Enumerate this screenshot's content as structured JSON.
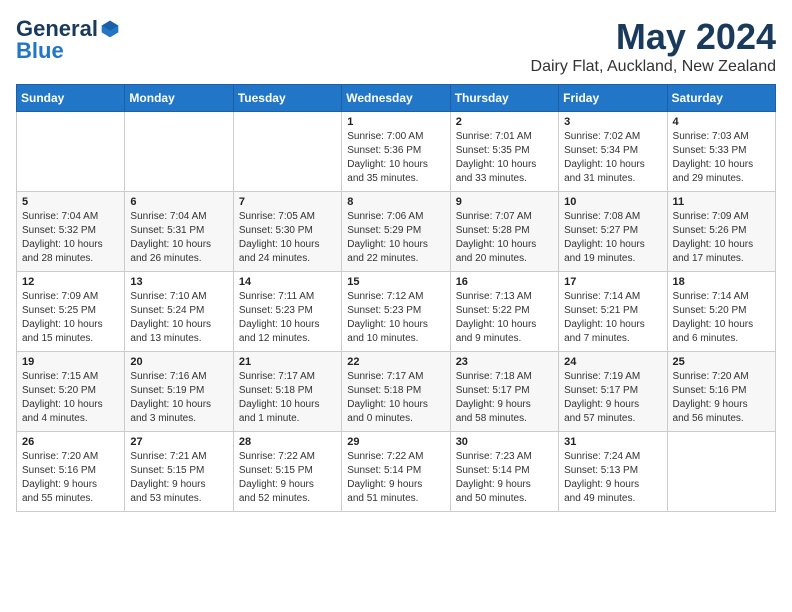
{
  "header": {
    "logo_general": "General",
    "logo_blue": "Blue",
    "month_title": "May 2024",
    "subtitle": "Dairy Flat, Auckland, New Zealand"
  },
  "days_of_week": [
    "Sunday",
    "Monday",
    "Tuesday",
    "Wednesday",
    "Thursday",
    "Friday",
    "Saturday"
  ],
  "weeks": [
    [
      {
        "day": "",
        "info": ""
      },
      {
        "day": "",
        "info": ""
      },
      {
        "day": "",
        "info": ""
      },
      {
        "day": "1",
        "info": "Sunrise: 7:00 AM\nSunset: 5:36 PM\nDaylight: 10 hours\nand 35 minutes."
      },
      {
        "day": "2",
        "info": "Sunrise: 7:01 AM\nSunset: 5:35 PM\nDaylight: 10 hours\nand 33 minutes."
      },
      {
        "day": "3",
        "info": "Sunrise: 7:02 AM\nSunset: 5:34 PM\nDaylight: 10 hours\nand 31 minutes."
      },
      {
        "day": "4",
        "info": "Sunrise: 7:03 AM\nSunset: 5:33 PM\nDaylight: 10 hours\nand 29 minutes."
      }
    ],
    [
      {
        "day": "5",
        "info": "Sunrise: 7:04 AM\nSunset: 5:32 PM\nDaylight: 10 hours\nand 28 minutes."
      },
      {
        "day": "6",
        "info": "Sunrise: 7:04 AM\nSunset: 5:31 PM\nDaylight: 10 hours\nand 26 minutes."
      },
      {
        "day": "7",
        "info": "Sunrise: 7:05 AM\nSunset: 5:30 PM\nDaylight: 10 hours\nand 24 minutes."
      },
      {
        "day": "8",
        "info": "Sunrise: 7:06 AM\nSunset: 5:29 PM\nDaylight: 10 hours\nand 22 minutes."
      },
      {
        "day": "9",
        "info": "Sunrise: 7:07 AM\nSunset: 5:28 PM\nDaylight: 10 hours\nand 20 minutes."
      },
      {
        "day": "10",
        "info": "Sunrise: 7:08 AM\nSunset: 5:27 PM\nDaylight: 10 hours\nand 19 minutes."
      },
      {
        "day": "11",
        "info": "Sunrise: 7:09 AM\nSunset: 5:26 PM\nDaylight: 10 hours\nand 17 minutes."
      }
    ],
    [
      {
        "day": "12",
        "info": "Sunrise: 7:09 AM\nSunset: 5:25 PM\nDaylight: 10 hours\nand 15 minutes."
      },
      {
        "day": "13",
        "info": "Sunrise: 7:10 AM\nSunset: 5:24 PM\nDaylight: 10 hours\nand 13 minutes."
      },
      {
        "day": "14",
        "info": "Sunrise: 7:11 AM\nSunset: 5:23 PM\nDaylight: 10 hours\nand 12 minutes."
      },
      {
        "day": "15",
        "info": "Sunrise: 7:12 AM\nSunset: 5:23 PM\nDaylight: 10 hours\nand 10 minutes."
      },
      {
        "day": "16",
        "info": "Sunrise: 7:13 AM\nSunset: 5:22 PM\nDaylight: 10 hours\nand 9 minutes."
      },
      {
        "day": "17",
        "info": "Sunrise: 7:14 AM\nSunset: 5:21 PM\nDaylight: 10 hours\nand 7 minutes."
      },
      {
        "day": "18",
        "info": "Sunrise: 7:14 AM\nSunset: 5:20 PM\nDaylight: 10 hours\nand 6 minutes."
      }
    ],
    [
      {
        "day": "19",
        "info": "Sunrise: 7:15 AM\nSunset: 5:20 PM\nDaylight: 10 hours\nand 4 minutes."
      },
      {
        "day": "20",
        "info": "Sunrise: 7:16 AM\nSunset: 5:19 PM\nDaylight: 10 hours\nand 3 minutes."
      },
      {
        "day": "21",
        "info": "Sunrise: 7:17 AM\nSunset: 5:18 PM\nDaylight: 10 hours\nand 1 minute."
      },
      {
        "day": "22",
        "info": "Sunrise: 7:17 AM\nSunset: 5:18 PM\nDaylight: 10 hours\nand 0 minutes."
      },
      {
        "day": "23",
        "info": "Sunrise: 7:18 AM\nSunset: 5:17 PM\nDaylight: 9 hours\nand 58 minutes."
      },
      {
        "day": "24",
        "info": "Sunrise: 7:19 AM\nSunset: 5:17 PM\nDaylight: 9 hours\nand 57 minutes."
      },
      {
        "day": "25",
        "info": "Sunrise: 7:20 AM\nSunset: 5:16 PM\nDaylight: 9 hours\nand 56 minutes."
      }
    ],
    [
      {
        "day": "26",
        "info": "Sunrise: 7:20 AM\nSunset: 5:16 PM\nDaylight: 9 hours\nand 55 minutes."
      },
      {
        "day": "27",
        "info": "Sunrise: 7:21 AM\nSunset: 5:15 PM\nDaylight: 9 hours\nand 53 minutes."
      },
      {
        "day": "28",
        "info": "Sunrise: 7:22 AM\nSunset: 5:15 PM\nDaylight: 9 hours\nand 52 minutes."
      },
      {
        "day": "29",
        "info": "Sunrise: 7:22 AM\nSunset: 5:14 PM\nDaylight: 9 hours\nand 51 minutes."
      },
      {
        "day": "30",
        "info": "Sunrise: 7:23 AM\nSunset: 5:14 PM\nDaylight: 9 hours\nand 50 minutes."
      },
      {
        "day": "31",
        "info": "Sunrise: 7:24 AM\nSunset: 5:13 PM\nDaylight: 9 hours\nand 49 minutes."
      },
      {
        "day": "",
        "info": ""
      }
    ]
  ]
}
